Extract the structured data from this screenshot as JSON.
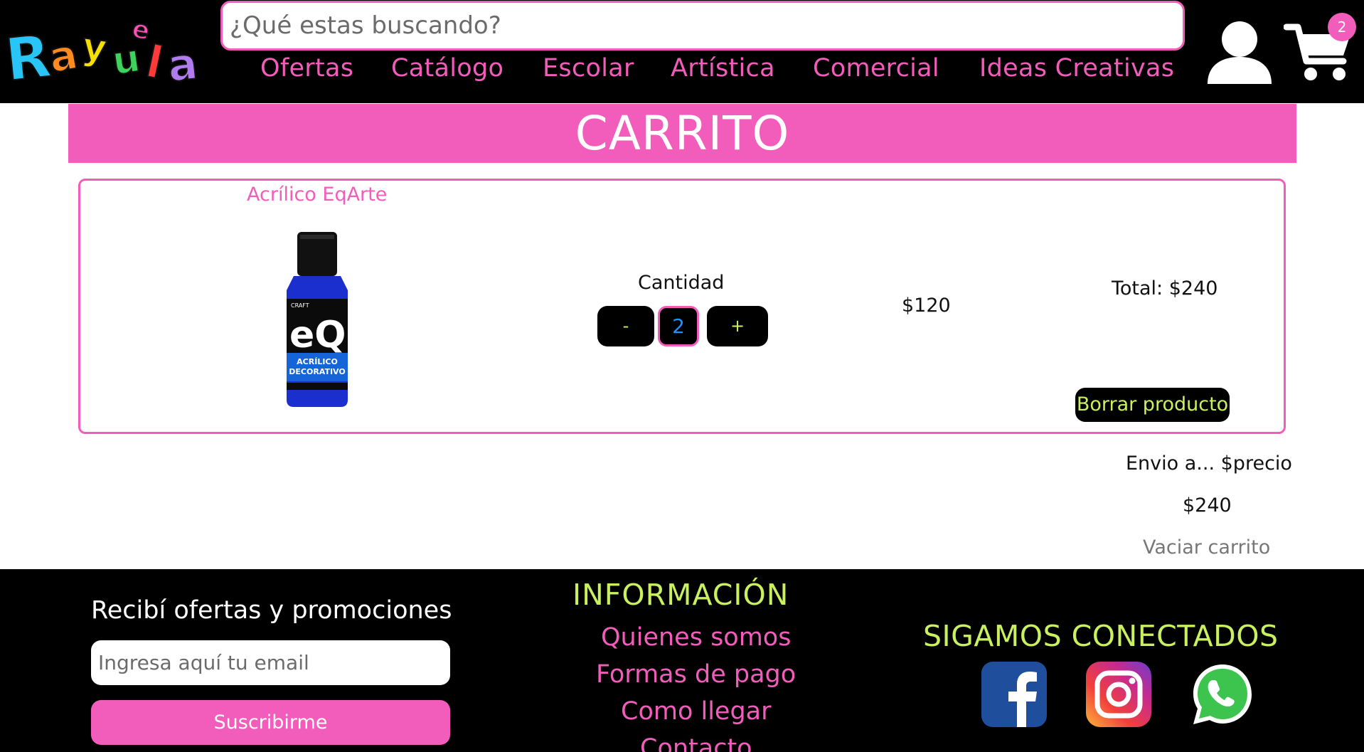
{
  "brand": {
    "logo_letters": [
      "R",
      "a",
      "y",
      "u",
      "e",
      "l",
      "a"
    ],
    "logo_colors": [
      "#29c5f6",
      "#ff8a1f",
      "#f6e000",
      "#3dd35c",
      "#ff4fb3",
      "#ff3a3a",
      "#b07cf0"
    ]
  },
  "header": {
    "search_placeholder": "¿Qué estas buscando?",
    "nav": [
      "Ofertas",
      "Catálogo",
      "Escolar",
      "Artística",
      "Comercial",
      "Ideas Creativas"
    ],
    "cart_count": "2",
    "icons": {
      "user": "user-icon",
      "cart": "cart-icon"
    }
  },
  "page": {
    "title": "CARRITO"
  },
  "cart": {
    "item": {
      "name": "Acrílico EqArte",
      "image_text": {
        "brand_small": "CRAFT",
        "brand": "eQ",
        "line1": "ACRÍLICO",
        "line2": "DECORATIVO"
      },
      "quantity_label": "Cantidad",
      "minus_label": "-",
      "quantity": "2",
      "plus_label": "+",
      "unit_price": "$120",
      "total": "Total: $240",
      "delete_label": "Borrar producto"
    },
    "shipping": "Envio a... $precio",
    "grand_total": "$240",
    "clear_label": "Vaciar carrito"
  },
  "footer": {
    "newsletter_title": "Recibí ofertas y promociones",
    "email_placeholder": "Ingresa aquí tu email",
    "subscribe_label": "Suscribirme",
    "info_title": "INFORMACIÓN",
    "info_links": [
      "Quienes somos",
      "Formas de pago",
      "Como llegar",
      "Contacto"
    ],
    "social_title": "SIGAMOS CONECTADOS",
    "social_icons": [
      "facebook-icon",
      "instagram-icon",
      "whatsapp-icon"
    ]
  },
  "colors": {
    "accent_pink": "#f25cba",
    "accent_lime": "#c9f15f",
    "header_bg": "#000000"
  }
}
